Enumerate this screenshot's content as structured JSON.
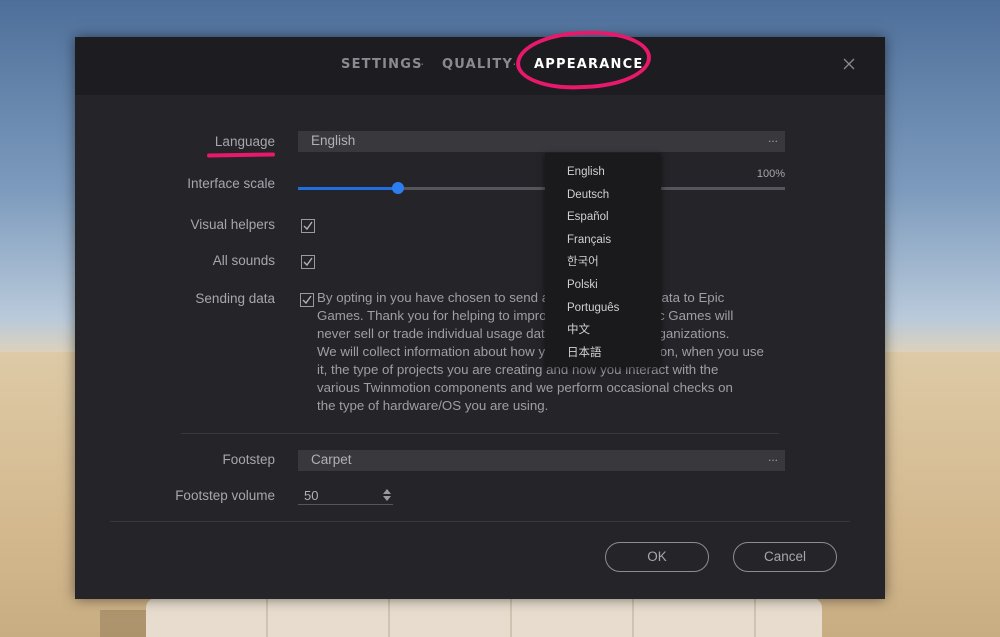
{
  "tabs": [
    {
      "label": "SETTINGS"
    },
    {
      "label": "QUALITY"
    },
    {
      "label": "APPEARANCE"
    }
  ],
  "tab_separator": "·",
  "active_tab": "APPEARANCE",
  "annotation_color": "#e8186b",
  "language": {
    "label": "Language",
    "value": "English",
    "dots": "..."
  },
  "interface_scale": {
    "label": "Interface scale",
    "value_text": "100%",
    "fraction": 0.205
  },
  "visual_helpers": {
    "label": "Visual helpers",
    "checked": true
  },
  "all_sounds": {
    "label": "All sounds",
    "checked": true
  },
  "sending_data": {
    "label": "Sending data",
    "checked": true,
    "lines": [
      "By opting in you have chosen to send anonymous usage data to Epic",
      "Games. Thank you for helping to improve Twinmotion. Epic Games will",
      "never sell or trade individual usage data with third-party organizations.",
      "We will collect information about how you use the application, when you use",
      "it, the type of projects you are creating and how you interact with the",
      "various Twinmotion components and we perform occasional checks on",
      "the type of hardware/OS you are using."
    ]
  },
  "footstep": {
    "label": "Footstep",
    "value": "Carpet",
    "dots": "..."
  },
  "footstep_volume": {
    "label": "Footstep volume",
    "value": "50"
  },
  "buttons": {
    "ok": "OK",
    "cancel": "Cancel"
  },
  "language_options": [
    "English",
    "Deutsch",
    "Español",
    "Français",
    "한국어",
    "Polski",
    "Português",
    "中文",
    "日本語"
  ],
  "accent_color": "#1f6fe0"
}
